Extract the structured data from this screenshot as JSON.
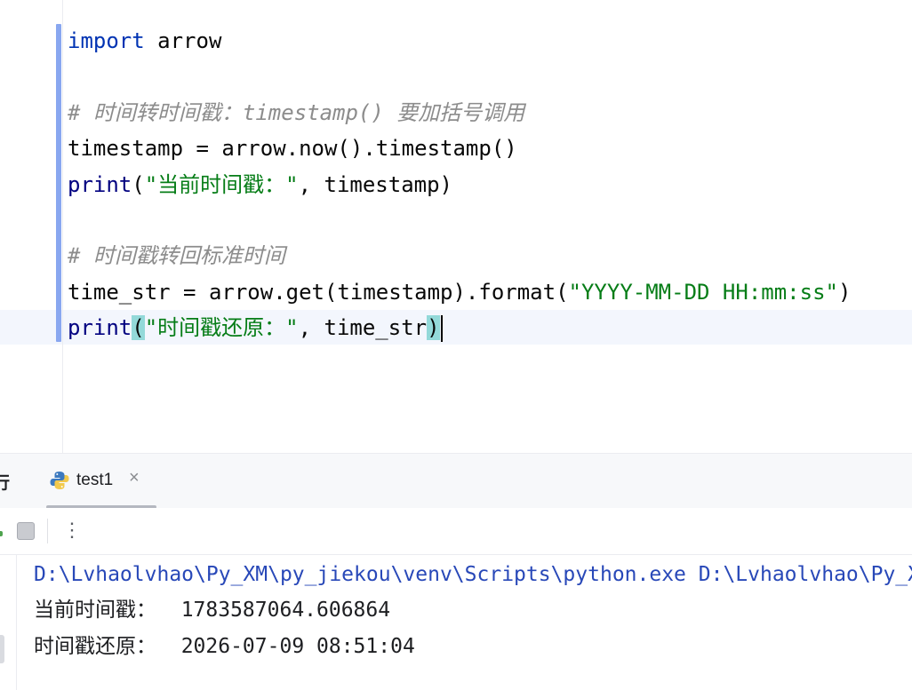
{
  "editor": {
    "lines": [
      {
        "kw": "import",
        "rest": " arrow"
      },
      {
        "comment": "# 时间转时间戳：timestamp() 要加括号调用"
      },
      {
        "text": "timestamp = arrow.now().timestamp()"
      },
      {
        "fn": "print",
        "open": "(",
        "str": "\"当前时间戳：\"",
        "rest": ", timestamp)"
      },
      {
        "comment": "# 时间戳转回标准时间"
      },
      {
        "pre": "time_str = arrow.get(timestamp).format(",
        "str": "\"YYYY-MM-DD HH:mm:ss\"",
        "post": ")"
      },
      {
        "fn": "print",
        "open": "(",
        "str": "\"时间戳还原：\"",
        "rest": ", time_str",
        "close": ")"
      }
    ]
  },
  "run_panel": {
    "title": "行",
    "tab_label": "test1",
    "tab_close": "×",
    "more_label": "⋮",
    "console": [
      "D:\\Lvhaolvhao\\Py_XM\\py_jiekou\\venv\\Scripts\\python.exe D:\\Lvhaolvhao\\Py_XM",
      "当前时间戳：  1783587064.606864",
      "时间戳还原：  2026-07-09 08:51:04"
    ]
  },
  "colors": {
    "keyword": "#0033b3",
    "builtin": "#000080",
    "string": "#067d17",
    "comment": "#8c8c8c",
    "console_command": "#2848b8",
    "change_marker": "#89a7f0"
  },
  "icons": {
    "python_file": "python-icon",
    "stop": "stop-icon",
    "more": "more-vertical-icon",
    "close": "close-icon"
  }
}
